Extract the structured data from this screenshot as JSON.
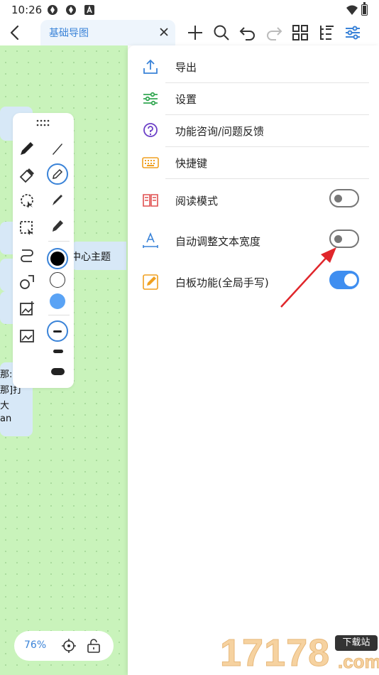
{
  "status_bar": {
    "time": "10:26"
  },
  "header": {
    "tab_title": "基础导图"
  },
  "canvas": {
    "central_topic": "中心主题",
    "node_text_lines": [
      "那:大",
      "那]打",
      "大",
      "an"
    ]
  },
  "zoom": {
    "level": "76%"
  },
  "menu": {
    "items": [
      {
        "label": "导出",
        "icon": "export-icon"
      },
      {
        "label": "设置",
        "icon": "settings-sliders-icon"
      },
      {
        "label": "功能咨询/问题反馈",
        "icon": "question-icon"
      },
      {
        "label": "快捷键",
        "icon": "keyboard-icon"
      },
      {
        "label": "阅读模式",
        "icon": "book-icon",
        "toggle": false
      },
      {
        "label": "自动调整文本宽度",
        "icon": "text-width-icon",
        "toggle": false
      },
      {
        "label": "白板功能(全局手写)",
        "icon": "whiteboard-icon",
        "toggle": true
      }
    ]
  },
  "palette": {
    "colors": [
      "#000000",
      "#ffffff",
      "#5aa3f5"
    ]
  },
  "colors": {
    "accent": "#3a83d8",
    "canvas": "#c9f3bb",
    "toggle_on": "#3f8ef0"
  },
  "watermark": {
    "number": "17178",
    "badge": "下载站",
    "suffix": ".com"
  }
}
